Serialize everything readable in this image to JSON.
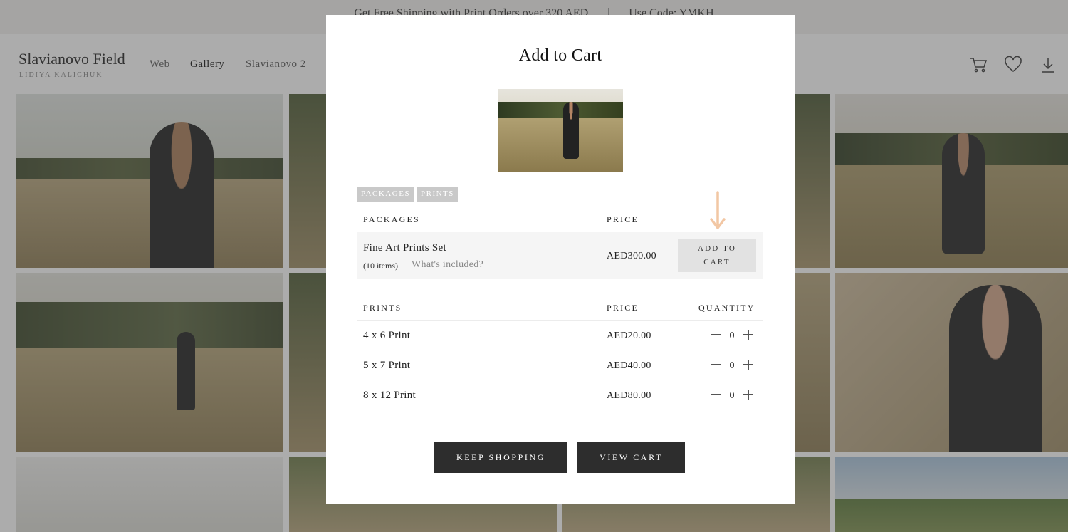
{
  "banner": {
    "shipping_text": "Get Free Shipping with Print Orders over 320 AED",
    "code_text": "Use Code: YMKH"
  },
  "header": {
    "title": "Slavianovo Field",
    "subtitle": "LIDIYA KALICHUK",
    "nav": [
      "Web",
      "Gallery",
      "Slavianovo 2"
    ],
    "icons": [
      "cart-icon",
      "heart-icon",
      "download-icon"
    ]
  },
  "modal": {
    "title": "Add to Cart",
    "tabs": [
      "PACKAGES",
      "PRINTS"
    ],
    "packages_table": {
      "headers": {
        "name": "PACKAGES",
        "price": "PRICE"
      },
      "rows": [
        {
          "name": "Fine Art Prints Set",
          "count": "(10 items)",
          "link": "What's included?",
          "price": "AED300.00",
          "button_line1": "ADD TO",
          "button_line2": "CART"
        }
      ]
    },
    "prints_table": {
      "headers": {
        "name": "PRINTS",
        "price": "PRICE",
        "quantity": "QUANTITY"
      },
      "rows": [
        {
          "name": "4 x 6 Print",
          "price": "AED20.00",
          "quantity": "0"
        },
        {
          "name": "5 x 7 Print",
          "price": "AED40.00",
          "quantity": "0"
        },
        {
          "name": "8 x 12 Print",
          "price": "AED80.00",
          "quantity": "0"
        }
      ]
    },
    "buttons": {
      "keep_shopping": "KEEP SHOPPING",
      "view_cart": "VIEW CART"
    },
    "colors": {
      "dark_button": "#2d2d2d",
      "arrow": "#f2c7a4",
      "chip": "#c9c9c9"
    }
  }
}
